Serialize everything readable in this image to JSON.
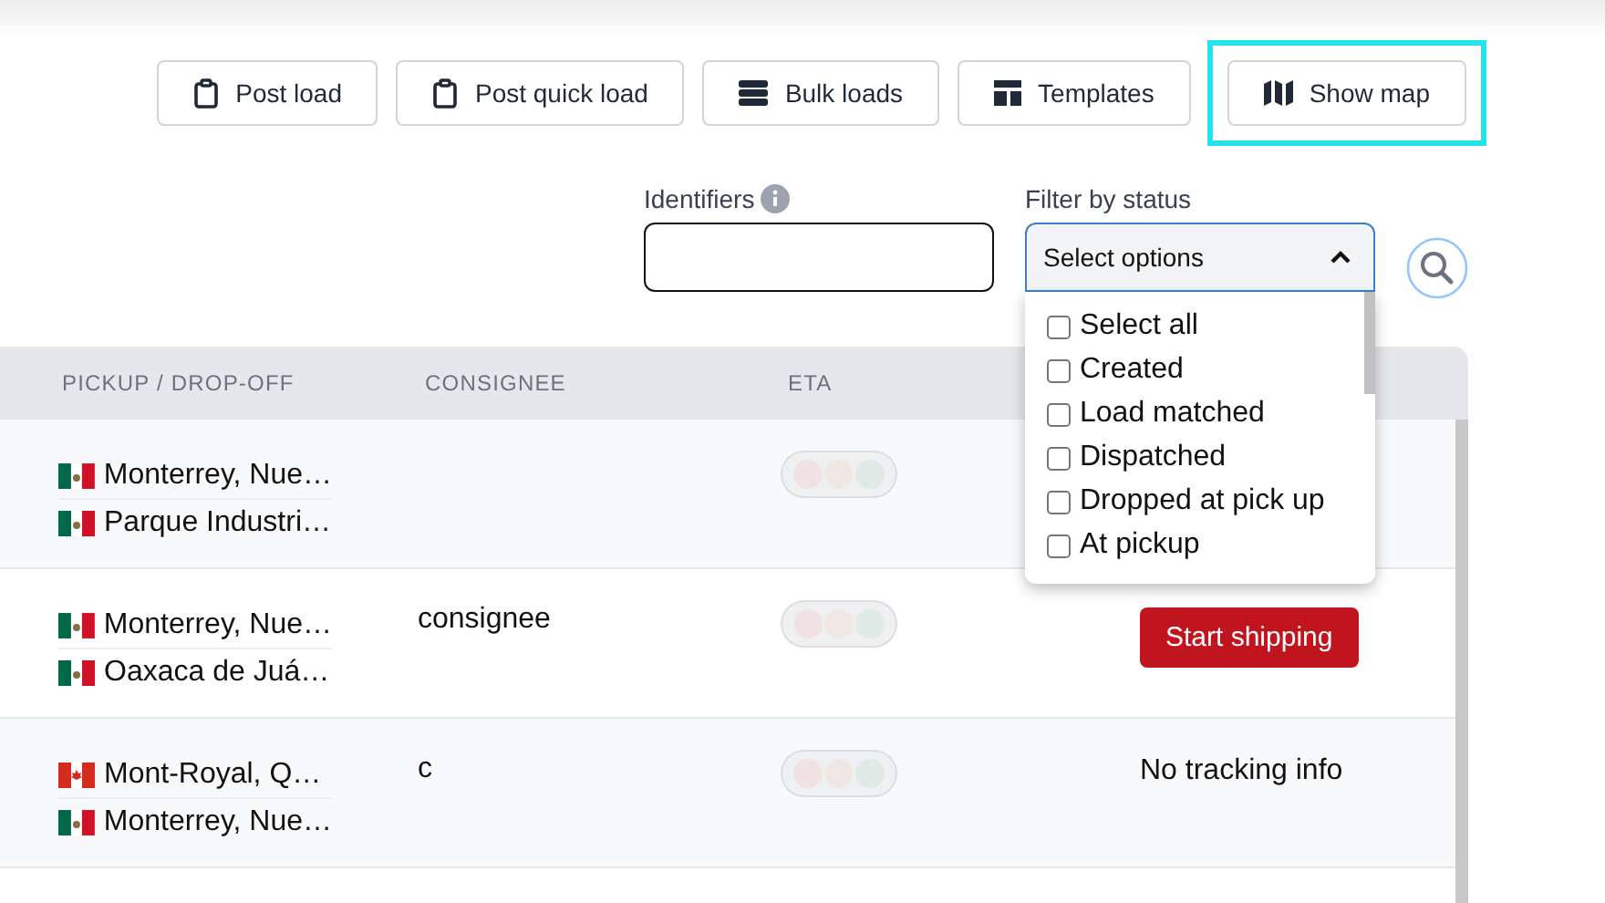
{
  "toolbar": {
    "buttons": [
      {
        "label": "Post load",
        "kind": "clipboard",
        "highlighted": false
      },
      {
        "label": "Post quick load",
        "kind": "clipboard",
        "highlighted": false
      },
      {
        "label": "Bulk loads",
        "kind": "stack",
        "highlighted": false
      },
      {
        "label": "Templates",
        "kind": "layout",
        "highlighted": false
      },
      {
        "label": "Show map",
        "kind": "map",
        "highlighted": true
      }
    ]
  },
  "filters": {
    "identifiers": {
      "label": "Identifiers"
    },
    "status": {
      "label": "Filter by status",
      "placeholder": "Select options",
      "expanded": true,
      "options": [
        {
          "label": "Select all",
          "checked": false
        },
        {
          "label": "Created",
          "checked": false
        },
        {
          "label": "Load matched",
          "checked": false
        },
        {
          "label": "Dispatched",
          "checked": false
        },
        {
          "label": "Dropped at pick up",
          "checked": false
        },
        {
          "label": "At pickup",
          "checked": false
        }
      ]
    }
  },
  "table": {
    "columns": [
      "PICKUP / DROP-OFF",
      "CONSIGNEE",
      "ETA"
    ],
    "rows": [
      {
        "stops": [
          {
            "kind": "mexico",
            "place": "Monterrey, Nue…"
          },
          {
            "kind": "mexico",
            "place": "Parque Industri…"
          }
        ]
      },
      {
        "stops": [
          {
            "kind": "mexico",
            "place": "Monterrey, Nue…"
          },
          {
            "kind": "mexico",
            "place": "Oaxaca de Juá…"
          }
        ],
        "consignee": "consignee",
        "status": {
          "kind": "button",
          "text": "Start shipping"
        }
      },
      {
        "stops": [
          {
            "kind": "canada",
            "place": "Mont-Royal, Q…"
          },
          {
            "kind": "mexico",
            "place": "Monterrey, Nue…"
          }
        ],
        "consignee": "c",
        "status": {
          "kind": "text",
          "text": "No tracking info"
        }
      }
    ]
  }
}
